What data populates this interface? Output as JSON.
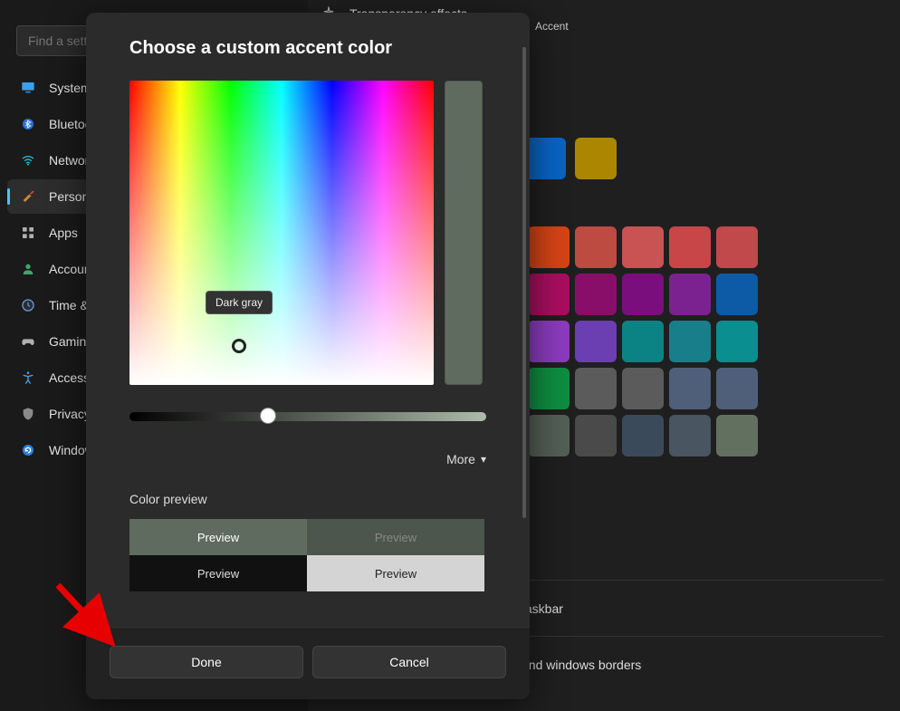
{
  "search": {
    "placeholder": "Find a setting"
  },
  "sidebar": {
    "items": [
      {
        "label": "System",
        "icon": "monitor-icon"
      },
      {
        "label": "Bluetooth",
        "icon": "bluetooth-icon"
      },
      {
        "label": "Network",
        "icon": "wifi-icon"
      },
      {
        "label": "Personalization",
        "icon": "brush-icon",
        "active": true
      },
      {
        "label": "Apps",
        "icon": "apps-icon"
      },
      {
        "label": "Accounts",
        "icon": "person-icon"
      },
      {
        "label": "Time & language",
        "icon": "clock-icon"
      },
      {
        "label": "Gaming",
        "icon": "gamepad-icon"
      },
      {
        "label": "Accessibility",
        "icon": "accessibility-icon"
      },
      {
        "label": "Privacy",
        "icon": "shield-icon"
      },
      {
        "label": "Windows Update",
        "icon": "update-icon"
      }
    ]
  },
  "background": {
    "headerText": "Transparency effects",
    "accentLabel": "Accent",
    "line_taskbar": "taskbar",
    "line_borders": "and windows borders",
    "row1": [
      "#0864c4",
      "#ad8600"
    ],
    "grid": [
      [
        "#d44316",
        "#bd4b41",
        "#c95252",
        "#c84648",
        "#c1484b"
      ],
      [
        "#a80e5e",
        "#890e6a",
        "#7b0e7d",
        "#7c2290",
        "#0d5aa7"
      ],
      [
        "#8a3bbd",
        "#6b3eb1",
        "#0b8385",
        "#187f8a",
        "#0a8e8f"
      ],
      [
        "#0f8d41",
        "#5b5b5b",
        "#5b5b5b",
        "#4f5e79",
        "#4f5e79"
      ],
      [
        "#525f55",
        "#4a4a4a",
        "#3a4a5a",
        "#4a5562",
        "#627060"
      ]
    ]
  },
  "modal": {
    "title": "Choose a custom accent color",
    "tooltip": "Dark gray",
    "moreLabel": "More",
    "cpLabel": "Color preview",
    "preview": {
      "cell1": "Preview",
      "cell2": "Preview",
      "cell3": "Preview",
      "cell4": "Preview"
    },
    "done": "Done",
    "cancel": "Cancel",
    "previewColor": "#5e6b5e",
    "lightPreview": "#d4d4d4"
  }
}
